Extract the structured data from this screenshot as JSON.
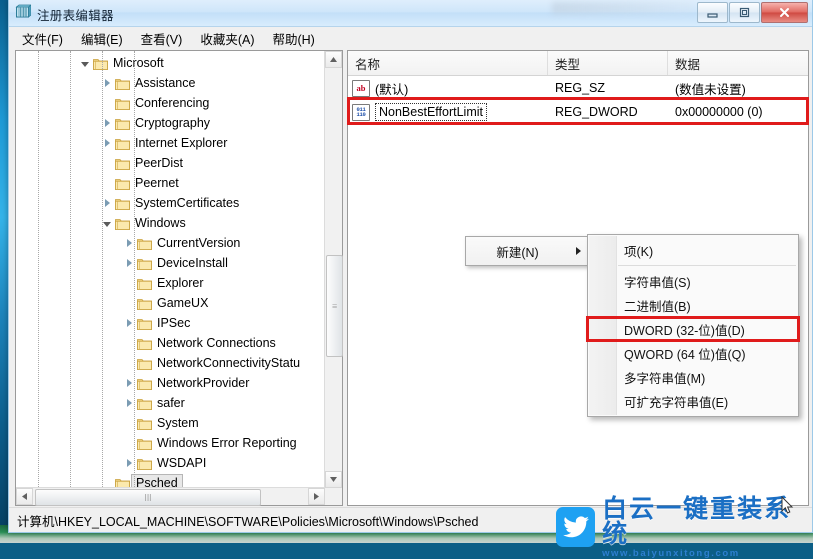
{
  "window": {
    "title": "注册表编辑器",
    "icon": "registry-editor-icon",
    "buttons": {
      "minimize": "minimize-icon",
      "maximize": "maximize-icon",
      "close": "close-icon"
    }
  },
  "menubar": {
    "items": [
      {
        "label": "文件(F)",
        "name": "menu-file"
      },
      {
        "label": "编辑(E)",
        "name": "menu-edit"
      },
      {
        "label": "查看(V)",
        "name": "menu-view"
      },
      {
        "label": "收藏夹(A)",
        "name": "menu-favorites"
      },
      {
        "label": "帮助(H)",
        "name": "menu-help"
      }
    ]
  },
  "tree": {
    "nodes": [
      {
        "label": "Microsoft",
        "indent": 0,
        "expander": "open",
        "selected": false
      },
      {
        "label": "Assistance",
        "indent": 1,
        "expander": "closed",
        "selected": false
      },
      {
        "label": "Conferencing",
        "indent": 1,
        "expander": "none",
        "selected": false
      },
      {
        "label": "Cryptography",
        "indent": 1,
        "expander": "closed",
        "selected": false
      },
      {
        "label": "Internet Explorer",
        "indent": 1,
        "expander": "closed",
        "selected": false
      },
      {
        "label": "PeerDist",
        "indent": 1,
        "expander": "none",
        "selected": false
      },
      {
        "label": "Peernet",
        "indent": 1,
        "expander": "none",
        "selected": false
      },
      {
        "label": "SystemCertificates",
        "indent": 1,
        "expander": "closed",
        "selected": false
      },
      {
        "label": "Windows",
        "indent": 1,
        "expander": "open",
        "selected": false
      },
      {
        "label": "CurrentVersion",
        "indent": 2,
        "expander": "closed",
        "selected": false
      },
      {
        "label": "DeviceInstall",
        "indent": 2,
        "expander": "closed",
        "selected": false
      },
      {
        "label": "Explorer",
        "indent": 2,
        "expander": "none",
        "selected": false
      },
      {
        "label": "GameUX",
        "indent": 2,
        "expander": "none",
        "selected": false
      },
      {
        "label": "IPSec",
        "indent": 2,
        "expander": "closed",
        "selected": false
      },
      {
        "label": "Network Connections",
        "indent": 2,
        "expander": "none",
        "selected": false
      },
      {
        "label": "NetworkConnectivityStatu",
        "indent": 2,
        "expander": "none",
        "selected": false
      },
      {
        "label": "NetworkProvider",
        "indent": 2,
        "expander": "closed",
        "selected": false
      },
      {
        "label": "safer",
        "indent": 2,
        "expander": "closed",
        "selected": false
      },
      {
        "label": "System",
        "indent": 2,
        "expander": "none",
        "selected": false
      },
      {
        "label": "Windows Error Reporting",
        "indent": 2,
        "expander": "none",
        "selected": false
      },
      {
        "label": "WSDAPI",
        "indent": 2,
        "expander": "closed",
        "selected": false
      },
      {
        "label": "Psched",
        "indent": 1,
        "expander": "none",
        "selected": true
      }
    ]
  },
  "values": {
    "columns": [
      {
        "label": "名称",
        "name": "column-name"
      },
      {
        "label": "类型",
        "name": "column-type"
      },
      {
        "label": "数据",
        "name": "column-data"
      }
    ],
    "rows": [
      {
        "icon": "string-value-icon",
        "name": "(默认)",
        "type": "REG_SZ",
        "data": "(数值未设置)",
        "highlighted": false,
        "focused": false
      },
      {
        "icon": "dword-value-icon",
        "name": "NonBestEffortLimit",
        "type": "REG_DWORD",
        "data": "0x00000000 (0)",
        "highlighted": true,
        "focused": true
      }
    ]
  },
  "context_menu": {
    "parent": {
      "label": "新建(N)",
      "submenu_arrow": "chevron-right-icon"
    },
    "items": [
      {
        "label": "项(K)",
        "highlighted": false
      },
      {
        "separator": true
      },
      {
        "label": "字符串值(S)",
        "highlighted": false
      },
      {
        "label": "二进制值(B)",
        "highlighted": false
      },
      {
        "label": "DWORD (32-位)值(D)",
        "highlighted": true
      },
      {
        "label": "QWORD (64 位)值(Q)",
        "highlighted": false
      },
      {
        "label": "多字符串值(M)",
        "highlighted": false
      },
      {
        "label": "可扩充字符串值(E)",
        "highlighted": false
      }
    ]
  },
  "status": {
    "path": "计算机\\HKEY_LOCAL_MACHINE\\SOFTWARE\\Policies\\Microsoft\\Windows\\Psched"
  },
  "watermark": {
    "title": "白云一键重装系统",
    "url": "www.baiyunxitong.com",
    "logo": "twitter-bird-icon"
  },
  "colors": {
    "annotation_red": "#e01b1b",
    "title_blue": "#c3dff8",
    "close_red": "#cf4a42",
    "watermark_blue": "#1b6fc4",
    "folder_yellow": "#f0cc66"
  }
}
